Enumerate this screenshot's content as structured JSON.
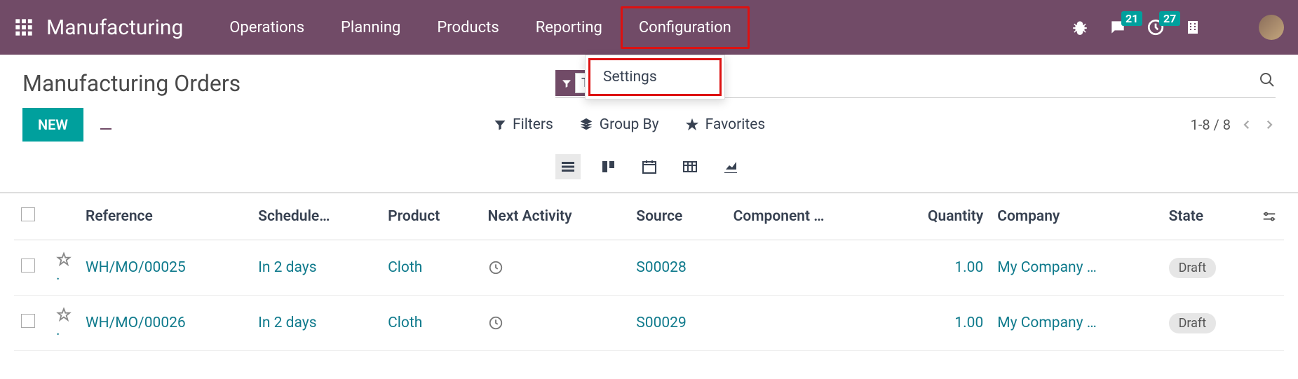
{
  "navbar": {
    "brand": "Manufacturing",
    "menu": [
      "Operations",
      "Planning",
      "Products",
      "Reporting",
      "Configuration"
    ],
    "highlighted_index": 4,
    "messages_badge": "21",
    "activities_badge": "27"
  },
  "dropdown": {
    "items": [
      "Settings"
    ],
    "highlighted_index": 0
  },
  "header": {
    "title": "Manufacturing Orders",
    "filter_chip_shown": "T"
  },
  "controls": {
    "new_label": "NEW",
    "filters_label": "Filters",
    "groupby_label": "Group By",
    "favorites_label": "Favorites",
    "pager": "1-8 / 8"
  },
  "table": {
    "columns": [
      "Reference",
      "Schedule…",
      "Product",
      "Next Activity",
      "Source",
      "Component …",
      "Quantity",
      "Company",
      "State"
    ],
    "rows": [
      {
        "reference": "WH/MO/00025",
        "schedule": "In 2 days",
        "product": "Cloth",
        "source": "S00028",
        "component": "",
        "quantity": "1.00",
        "company": "My Company …",
        "state": "Draft"
      },
      {
        "reference": "WH/MO/00026",
        "schedule": "In 2 days",
        "product": "Cloth",
        "source": "S00029",
        "component": "",
        "quantity": "1.00",
        "company": "My Company …",
        "state": "Draft"
      }
    ]
  }
}
